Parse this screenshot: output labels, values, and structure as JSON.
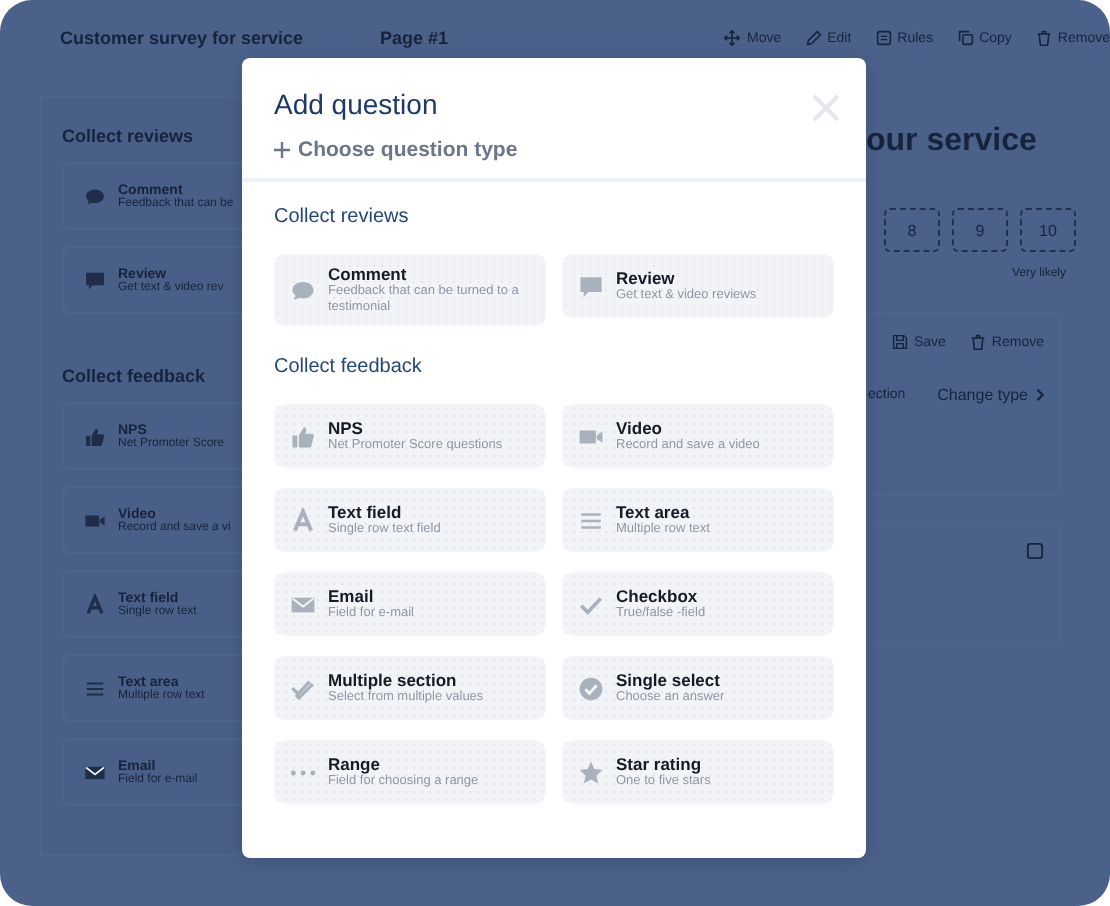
{
  "background": {
    "title": "Customer survey for service",
    "page": "Page #1",
    "toolbar": [
      {
        "kind": "move",
        "label": "Move"
      },
      {
        "kind": "edit",
        "label": "Edit"
      },
      {
        "kind": "rules",
        "label": "Rules"
      },
      {
        "kind": "copy",
        "label": "Copy"
      },
      {
        "kind": "trash",
        "label": "Remove"
      }
    ],
    "sections": [
      {
        "title": "Collect reviews",
        "items": [
          {
            "kind": "comment",
            "label": "Comment",
            "description": "Feedback that can be"
          },
          {
            "kind": "review",
            "label": "Review",
            "description": "Get text & video rev"
          }
        ]
      },
      {
        "title": "Collect feedback",
        "items": [
          {
            "kind": "thumb",
            "label": "NPS",
            "description": "Net Promoter Score"
          },
          {
            "kind": "video",
            "label": "Video",
            "description": "Record and save a vi"
          },
          {
            "kind": "letter",
            "label": "Text field",
            "description": "Single row text"
          },
          {
            "kind": "lines",
            "label": "Text area",
            "description": "Multiple row text"
          },
          {
            "kind": "mail",
            "label": "Email",
            "description": "Field for e-mail"
          }
        ]
      }
    ],
    "heading": "our service",
    "scale": [
      "8",
      "9",
      "10"
    ],
    "scale_end": "Very likely",
    "actions": [
      {
        "kind": "save",
        "label": "Save"
      },
      {
        "kind": "trash",
        "label": "Remove"
      }
    ],
    "fragment": "ection",
    "change_type": "Change type"
  },
  "modal": {
    "title": "Add question",
    "subtitle": "Choose question type",
    "sections": [
      {
        "title": "Collect reviews",
        "items": [
          {
            "kind": "comment",
            "label": "Comment",
            "description": "Feedback that can be turned to a testimonial"
          },
          {
            "kind": "review",
            "label": "Review",
            "description": "Get text & video reviews"
          }
        ]
      },
      {
        "title": "Collect feedback",
        "items": [
          {
            "kind": "thumb",
            "label": "NPS",
            "description": "Net Promoter Score questions"
          },
          {
            "kind": "video",
            "label": "Video",
            "description": "Record and save a video"
          },
          {
            "kind": "letter",
            "label": "Text field",
            "description": "Single row text field"
          },
          {
            "kind": "lines",
            "label": "Text area",
            "description": "Multiple row text"
          },
          {
            "kind": "mail",
            "label": "Email",
            "description": "Field for e-mail"
          },
          {
            "kind": "check",
            "label": "Checkbox",
            "description": "True/false -field"
          },
          {
            "kind": "doublecheck",
            "label": "Multiple section",
            "description": "Select from multiple values"
          },
          {
            "kind": "circlecheck",
            "label": "Single select",
            "description": "Choose an answer"
          },
          {
            "kind": "dots",
            "label": "Range",
            "description": "Field for choosing a range"
          },
          {
            "kind": "star",
            "label": "Star rating",
            "description": "One to five stars"
          }
        ]
      }
    ]
  }
}
